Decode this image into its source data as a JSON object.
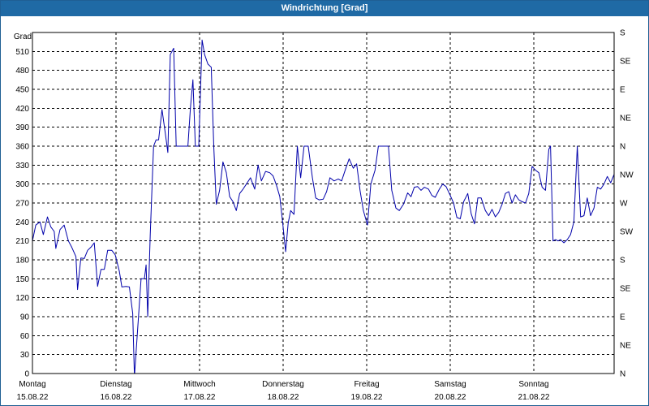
{
  "window": {
    "title": "Windrichtung [Grad]"
  },
  "colors": {
    "titlebar": "#1f6aa5",
    "series": "#0000aa",
    "grid": "#000000"
  },
  "chart_data": {
    "type": "line",
    "title": "Windrichtung [Grad]",
    "ylabel": "Grad",
    "ylim": [
      0,
      540
    ],
    "yticks": [
      0,
      30,
      60,
      90,
      120,
      150,
      180,
      210,
      240,
      270,
      300,
      330,
      360,
      390,
      420,
      450,
      480,
      510
    ],
    "right_ticks": [
      {
        "value": 0,
        "label": "N"
      },
      {
        "value": 45,
        "label": "NE"
      },
      {
        "value": 90,
        "label": "E"
      },
      {
        "value": 135,
        "label": "SE"
      },
      {
        "value": 180,
        "label": "S"
      },
      {
        "value": 225,
        "label": "SW"
      },
      {
        "value": 270,
        "label": "W"
      },
      {
        "value": 315,
        "label": "NW"
      },
      {
        "value": 360,
        "label": "N"
      },
      {
        "value": 405,
        "label": "NE"
      },
      {
        "value": 450,
        "label": "E"
      },
      {
        "value": 495,
        "label": "SE"
      },
      {
        "value": 540,
        "label": "S"
      }
    ],
    "xlim": [
      0,
      7
    ],
    "x_ticks": [
      {
        "day": 0,
        "weekday": "Montag",
        "date": "15.08.22"
      },
      {
        "day": 1,
        "weekday": "Dienstag",
        "date": "16.08.22"
      },
      {
        "day": 2,
        "weekday": "Mittwoch",
        "date": "17.08.22"
      },
      {
        "day": 3,
        "weekday": "Donnerstag",
        "date": "18.08.22"
      },
      {
        "day": 4,
        "weekday": "Freitag",
        "date": "19.08.22"
      },
      {
        "day": 5,
        "weekday": "Samstag",
        "date": "20.08.22"
      },
      {
        "day": 6,
        "weekday": "Sonntag",
        "date": "21.08.22"
      }
    ],
    "grid": true,
    "series": [
      {
        "values": [
          [
            0.0,
            210
          ],
          [
            0.04,
            235
          ],
          [
            0.09,
            240
          ],
          [
            0.13,
            220
          ],
          [
            0.18,
            248
          ],
          [
            0.22,
            232
          ],
          [
            0.26,
            225
          ],
          [
            0.28,
            198
          ],
          [
            0.33,
            228
          ],
          [
            0.38,
            235
          ],
          [
            0.43,
            210
          ],
          [
            0.47,
            200
          ],
          [
            0.52,
            185
          ],
          [
            0.54,
            133
          ],
          [
            0.58,
            183
          ],
          [
            0.62,
            182
          ],
          [
            0.66,
            195
          ],
          [
            0.7,
            200
          ],
          [
            0.74,
            207
          ],
          [
            0.78,
            138
          ],
          [
            0.82,
            165
          ],
          [
            0.86,
            165
          ],
          [
            0.9,
            195
          ],
          [
            0.95,
            195
          ],
          [
            0.99,
            188
          ],
          [
            1.04,
            162
          ],
          [
            1.07,
            137
          ],
          [
            1.12,
            138
          ],
          [
            1.16,
            137
          ],
          [
            1.2,
            95
          ],
          [
            1.22,
            -5
          ],
          [
            1.3,
            150
          ],
          [
            1.34,
            150
          ],
          [
            1.36,
            172
          ],
          [
            1.38,
            90
          ],
          [
            1.41,
            220
          ],
          [
            1.45,
            360
          ],
          [
            1.48,
            370
          ],
          [
            1.51,
            370
          ],
          [
            1.55,
            418
          ],
          [
            1.59,
            380
          ],
          [
            1.62,
            350
          ],
          [
            1.65,
            505
          ],
          [
            1.69,
            515
          ],
          [
            1.72,
            360
          ],
          [
            1.76,
            360
          ],
          [
            1.81,
            360
          ],
          [
            1.86,
            360
          ],
          [
            1.89,
            420
          ],
          [
            1.92,
            465
          ],
          [
            1.95,
            360
          ],
          [
            1.99,
            360
          ],
          [
            2.03,
            528
          ],
          [
            2.06,
            505
          ],
          [
            2.1,
            490
          ],
          [
            2.14,
            485
          ],
          [
            2.17,
            360
          ],
          [
            2.2,
            268
          ],
          [
            2.24,
            290
          ],
          [
            2.28,
            335
          ],
          [
            2.32,
            318
          ],
          [
            2.36,
            280
          ],
          [
            2.4,
            272
          ],
          [
            2.44,
            258
          ],
          [
            2.48,
            285
          ],
          [
            2.52,
            292
          ],
          [
            2.56,
            300
          ],
          [
            2.61,
            310
          ],
          [
            2.66,
            292
          ],
          [
            2.7,
            330
          ],
          [
            2.74,
            305
          ],
          [
            2.79,
            320
          ],
          [
            2.84,
            318
          ],
          [
            2.88,
            313
          ],
          [
            2.92,
            298
          ],
          [
            2.96,
            280
          ],
          [
            3.0,
            232
          ],
          [
            3.03,
            193
          ],
          [
            3.06,
            238
          ],
          [
            3.09,
            258
          ],
          [
            3.13,
            252
          ],
          [
            3.17,
            360
          ],
          [
            3.21,
            310
          ],
          [
            3.25,
            360
          ],
          [
            3.3,
            360
          ],
          [
            3.35,
            310
          ],
          [
            3.39,
            278
          ],
          [
            3.43,
            275
          ],
          [
            3.48,
            276
          ],
          [
            3.52,
            288
          ],
          [
            3.56,
            310
          ],
          [
            3.61,
            305
          ],
          [
            3.66,
            308
          ],
          [
            3.7,
            305
          ],
          [
            3.75,
            325
          ],
          [
            3.79,
            340
          ],
          [
            3.84,
            325
          ],
          [
            3.88,
            332
          ],
          [
            3.92,
            290
          ],
          [
            3.96,
            258
          ],
          [
            4.01,
            235
          ],
          [
            4.05,
            300
          ],
          [
            4.1,
            322
          ],
          [
            4.14,
            360
          ],
          [
            4.18,
            360
          ],
          [
            4.22,
            360
          ],
          [
            4.26,
            360
          ],
          [
            4.3,
            290
          ],
          [
            4.35,
            262
          ],
          [
            4.39,
            258
          ],
          [
            4.44,
            268
          ],
          [
            4.49,
            286
          ],
          [
            4.53,
            280
          ],
          [
            4.57,
            295
          ],
          [
            4.61,
            296
          ],
          [
            4.65,
            290
          ],
          [
            4.69,
            295
          ],
          [
            4.74,
            292
          ],
          [
            4.78,
            282
          ],
          [
            4.82,
            279
          ],
          [
            4.87,
            292
          ],
          [
            4.91,
            300
          ],
          [
            4.95,
            296
          ],
          [
            5.0,
            282
          ],
          [
            5.04,
            270
          ],
          [
            5.08,
            247
          ],
          [
            5.12,
            245
          ],
          [
            5.16,
            272
          ],
          [
            5.21,
            285
          ],
          [
            5.25,
            253
          ],
          [
            5.29,
            237
          ],
          [
            5.33,
            278
          ],
          [
            5.37,
            278
          ],
          [
            5.42,
            258
          ],
          [
            5.46,
            250
          ],
          [
            5.5,
            260
          ],
          [
            5.54,
            248
          ],
          [
            5.58,
            255
          ],
          [
            5.62,
            268
          ],
          [
            5.66,
            285
          ],
          [
            5.7,
            288
          ],
          [
            5.74,
            270
          ],
          [
            5.78,
            283
          ],
          [
            5.82,
            275
          ],
          [
            5.86,
            272
          ],
          [
            5.9,
            270
          ],
          [
            5.94,
            285
          ],
          [
            5.98,
            328
          ],
          [
            6.02,
            322
          ],
          [
            6.06,
            318
          ],
          [
            6.1,
            295
          ],
          [
            6.14,
            290
          ],
          [
            6.18,
            355
          ],
          [
            6.2,
            360
          ],
          [
            6.23,
            210
          ],
          [
            6.26,
            212
          ],
          [
            6.29,
            210
          ],
          [
            6.32,
            212
          ],
          [
            6.36,
            207
          ],
          [
            6.4,
            212
          ],
          [
            6.44,
            220
          ],
          [
            6.48,
            240
          ],
          [
            6.52,
            360
          ],
          [
            6.56,
            248
          ],
          [
            6.6,
            250
          ],
          [
            6.64,
            278
          ],
          [
            6.68,
            250
          ],
          [
            6.72,
            262
          ],
          [
            6.76,
            295
          ],
          [
            6.8,
            292
          ],
          [
            6.84,
            300
          ],
          [
            6.88,
            312
          ],
          [
            6.92,
            302
          ],
          [
            6.96,
            315
          ],
          [
            7.0,
            328
          ],
          [
            7.04,
            328
          ],
          [
            7.08,
            338
          ],
          [
            7.12,
            340
          ]
        ]
      }
    ]
  }
}
